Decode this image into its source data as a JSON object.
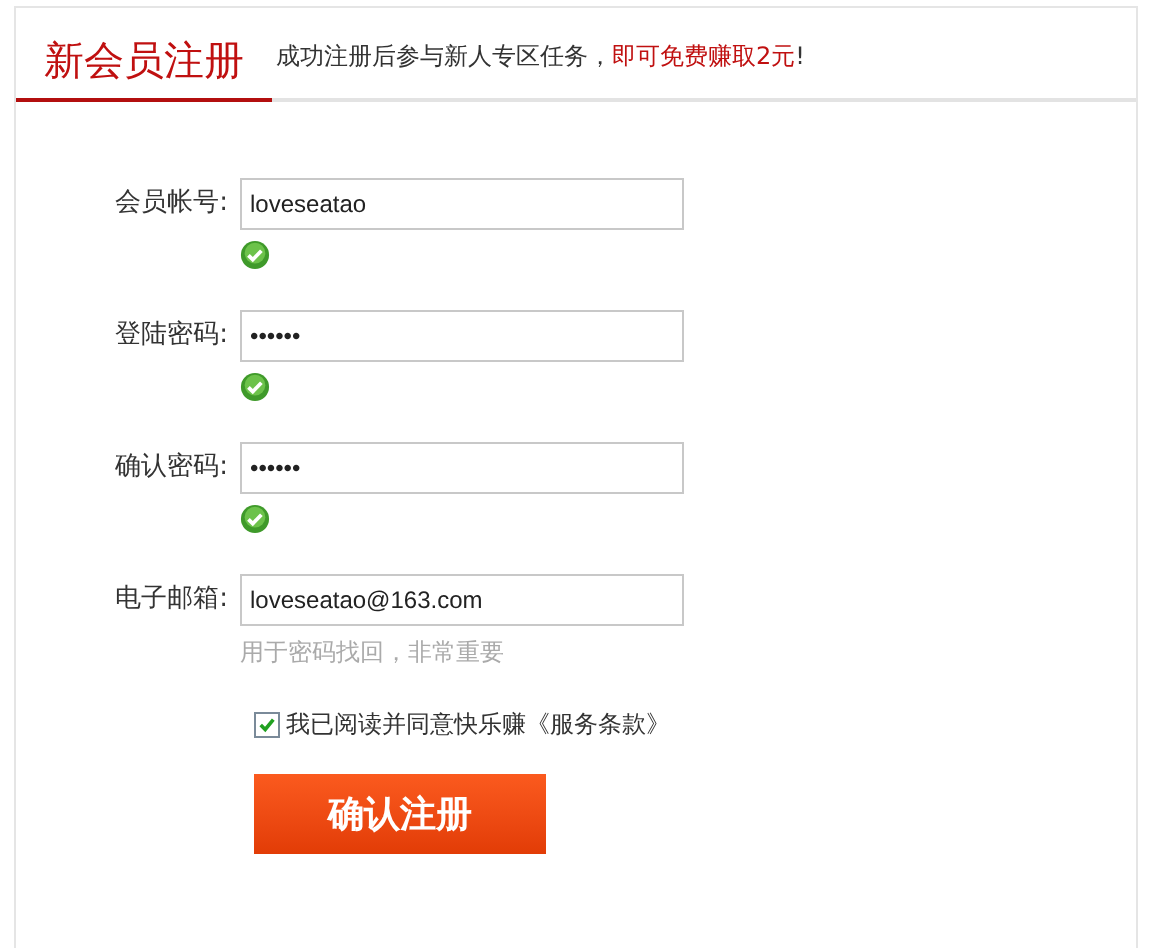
{
  "header": {
    "title": "新会员注册",
    "subtitle": [
      {
        "text": "成功注册后参与新人专区任务，",
        "emphasis": false
      },
      {
        "text": "即可免费赚取2元",
        "emphasis": true
      },
      {
        "text": "!",
        "emphasis": false
      }
    ]
  },
  "fields": [
    {
      "label": "会员帐号:",
      "value": "loveseatao",
      "valid": true
    },
    {
      "label": "登陆密码:",
      "value": "••••••",
      "valid": true
    },
    {
      "label": "确认密码:",
      "value": "••••••",
      "valid": true
    },
    {
      "label": "电子邮箱:",
      "value": "loveseatao@163.com",
      "valid": false,
      "hint": "用于密码找回，非常重要"
    }
  ],
  "agreement": {
    "text": "我已阅读并同意快乐赚《服务条款》",
    "checked": true
  },
  "submit": "确认注册"
}
